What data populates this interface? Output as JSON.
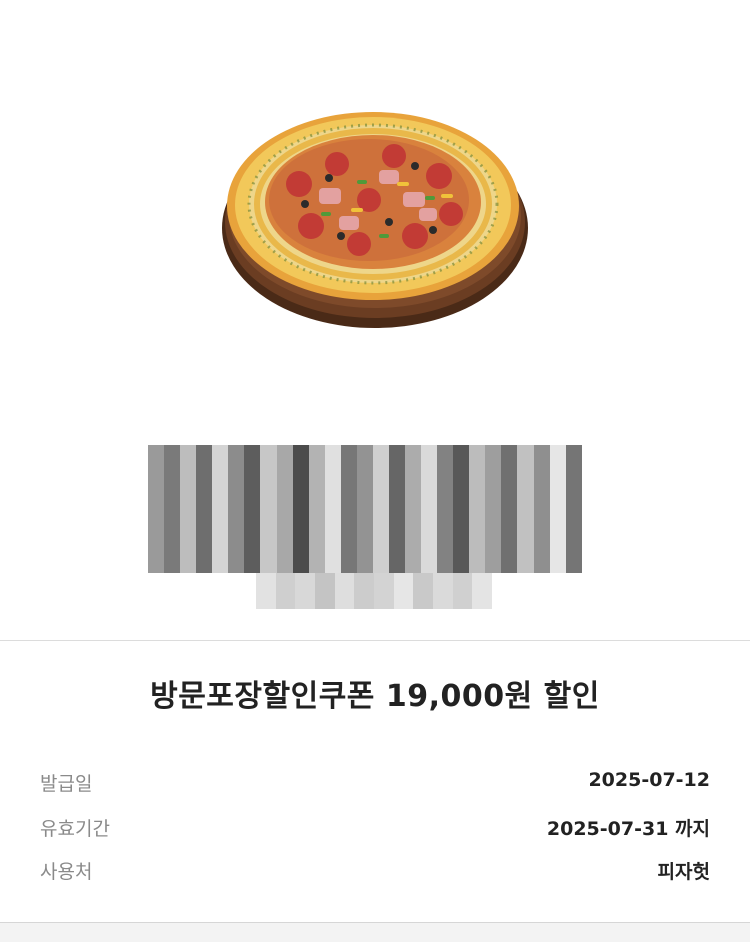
{
  "product": {
    "image_icon": "pizza-image"
  },
  "coupon": {
    "title": "방문포장할인쿠폰 19,000원 할인",
    "details": [
      {
        "label": "발급일",
        "value": "2025-07-12"
      },
      {
        "label": "유효기간",
        "value": "2025-07-31 까지"
      },
      {
        "label": "사용처",
        "value": "피자헛"
      }
    ]
  },
  "colors": {
    "title_text": "#222222",
    "label_text": "#8a8a8a",
    "divider": "#dcdcdc"
  }
}
